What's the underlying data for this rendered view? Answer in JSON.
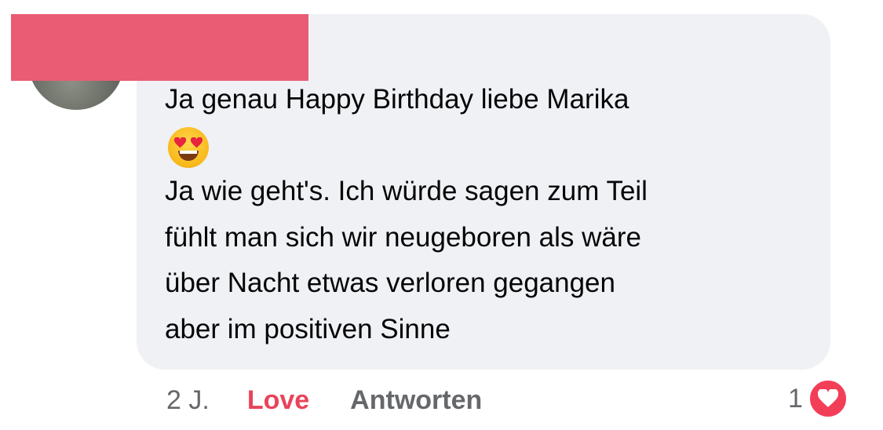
{
  "comment": {
    "lines": [
      "Ja genau Happy Birthday liebe Marika",
      "Ja wie geht's. Ich würde sagen zum Teil",
      "fühlt man sich wir neugeboren als wäre",
      "über Nacht etwas verloren gegangen",
      "aber im positiven Sinne"
    ],
    "emoji": "smiling-face-with-heart-eyes"
  },
  "actions": {
    "time": "2 J.",
    "love_label": "Love",
    "reply_label": "Antworten"
  },
  "reactions": {
    "count": "1",
    "type": "heart-icon"
  },
  "colors": {
    "bubble": "#f0f1f5",
    "love": "#e8445a",
    "heart_badge": "#f33e58",
    "redaction": "#e95c73"
  }
}
